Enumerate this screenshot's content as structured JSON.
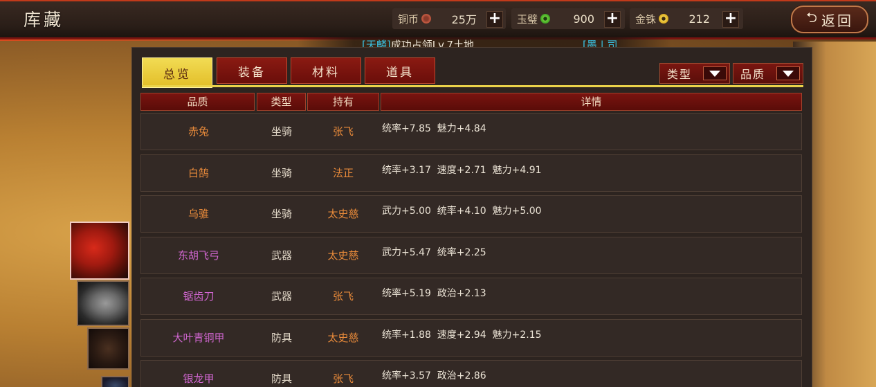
{
  "header": {
    "title": "库藏",
    "back_label": "返回"
  },
  "currencies": [
    {
      "name": "铜币",
      "icon": "copper-coin-icon",
      "value": "25万"
    },
    {
      "name": "玉璧",
      "icon": "jade-disc-icon",
      "value": "900"
    },
    {
      "name": "金铢",
      "icon": "gold-coin-icon",
      "value": "212"
    }
  ],
  "marquee": {
    "tag": "[天麟]",
    "message": "成功占领Lv.7土地",
    "second_prefix": "[墨 | 司"
  },
  "tabs": [
    {
      "label": "总览",
      "active": true
    },
    {
      "label": "装备",
      "active": false
    },
    {
      "label": "材料",
      "active": false
    },
    {
      "label": "道具",
      "active": false
    }
  ],
  "filters": [
    {
      "label": "类型"
    },
    {
      "label": "品质"
    }
  ],
  "columns": [
    "品质",
    "类型",
    "持有",
    "详情"
  ],
  "rows": [
    {
      "name": "赤兔",
      "quality": "orange",
      "type": "坐骑",
      "owner": "张飞",
      "detail": "统率+7.85  魅力+4.84"
    },
    {
      "name": "白鹄",
      "quality": "orange",
      "type": "坐骑",
      "owner": "法正",
      "detail": "统率+3.17  速度+2.71  魅力+4.91"
    },
    {
      "name": "乌骓",
      "quality": "orange",
      "type": "坐骑",
      "owner": "太史慈",
      "detail": "武力+5.00  统率+4.10  魅力+5.00"
    },
    {
      "name": "东胡飞弓",
      "quality": "purple",
      "type": "武器",
      "owner": "太史慈",
      "detail": "武力+5.47  统率+2.25"
    },
    {
      "name": "锯齿刀",
      "quality": "purple",
      "type": "武器",
      "owner": "张飞",
      "detail": "统率+5.19  政治+2.13"
    },
    {
      "name": "大叶青铜甲",
      "quality": "purple",
      "type": "防具",
      "owner": "太史慈",
      "detail": "统率+1.88  速度+2.94  魅力+2.15"
    },
    {
      "name": "银龙甲",
      "quality": "purple",
      "type": "防具",
      "owner": "张飞",
      "detail": "统率+3.57  政治+2.86"
    }
  ],
  "colors": {
    "accent_red": "#7a1410",
    "active_tab": "#e2bd28",
    "quality_orange": "#e88a3a",
    "quality_purple": "#d066d0"
  }
}
